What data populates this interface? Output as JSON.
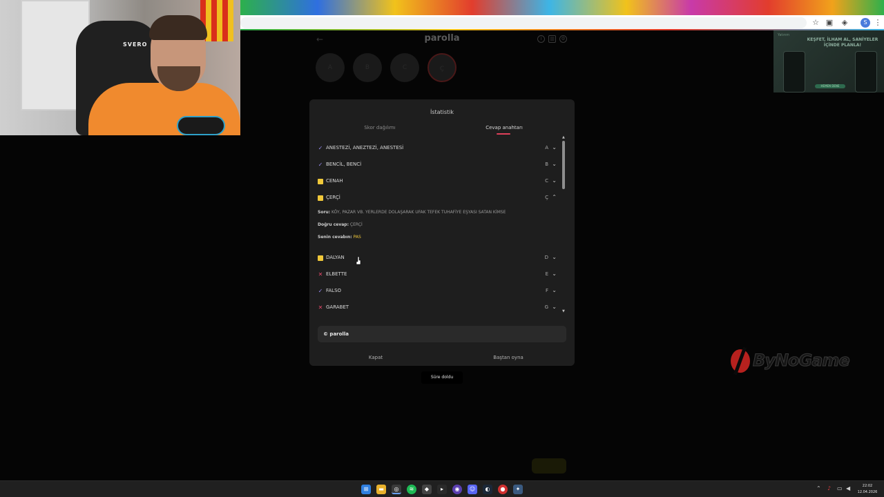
{
  "game": {
    "title": "parolla",
    "circles": [
      "A",
      "B",
      "C",
      "Ç"
    ]
  },
  "modal": {
    "title": "İstatistik",
    "tabs": [
      {
        "label": "Skor dağılımı",
        "active": false
      },
      {
        "label": "Cevap anahtarı",
        "active": true
      }
    ],
    "answers": [
      {
        "word": "ANESTEZİ, ANEZTEZİ, ANESTESİ",
        "letter": "A",
        "status": "correct"
      },
      {
        "word": "BENCİL, BENCİ",
        "letter": "B",
        "status": "correct"
      },
      {
        "word": "CENAH",
        "letter": "C",
        "status": "pass"
      },
      {
        "word": "ÇERÇİ",
        "letter": "Ç",
        "status": "pass",
        "expanded": true
      },
      {
        "word": "DALYAN",
        "letter": "D",
        "status": "pass"
      },
      {
        "word": "ELBETTE",
        "letter": "E",
        "status": "wrong"
      },
      {
        "word": "FALSO",
        "letter": "F",
        "status": "correct"
      },
      {
        "word": "GARABET",
        "letter": "G",
        "status": "wrong"
      }
    ],
    "detail": {
      "question_label": "Soru:",
      "question": "KÖY, PAZAR VB. YERLERDE DOLAŞARAK UFAK TEFEK TUHAFİYE EŞYASI SATAN KİMSE",
      "correct_label": "Doğru cevap:",
      "correct": "ÇERÇİ",
      "yours_label": "Senin cevabın:",
      "yours": "PAS"
    },
    "brand": "© parolla",
    "close_label": "Kapat",
    "restart_label": "Baştan oyna"
  },
  "toast": "Süre doldu",
  "ad": {
    "brand": "Yatırım",
    "text": "KEŞFET, İLHAM AL, SANİYELER İÇİNDE PLANLA!",
    "cta": "HEMEN DENE"
  },
  "watermark": "ByNoGame",
  "webcam": {
    "chair_brand": "SVERO"
  },
  "taskbar": {
    "time": "22:02",
    "date": "12.04.2026"
  },
  "colors": {
    "correct": "#9a8cf0",
    "pass": "#f0c83a",
    "wrong": "#e8486a",
    "tab_accent": "#e0405a",
    "modal_bg": "#1e1e1e"
  }
}
